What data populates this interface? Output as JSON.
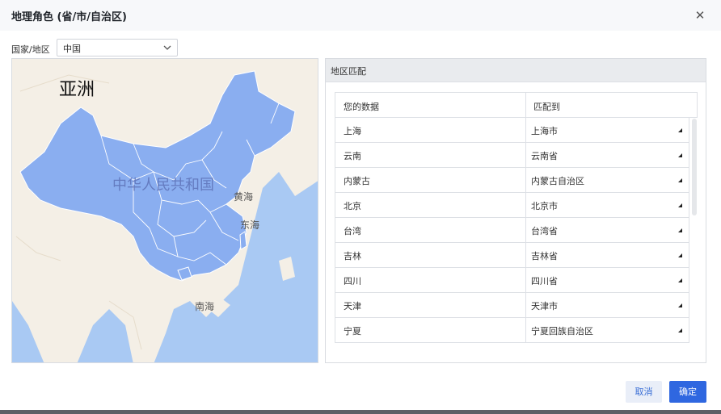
{
  "dialog": {
    "title": "地理角色 (省/市/自治区)",
    "close_glyph": "✕"
  },
  "country": {
    "label": "国家/地区",
    "value": "中国"
  },
  "map": {
    "labels": {
      "asia": "亚洲",
      "country": "中华人民共和国",
      "yellow_sea": "黄海",
      "east_sea": "东海",
      "south_sea": "南海"
    },
    "colors": {
      "water": "#a9c9f3",
      "land": "#f4efe6",
      "region": "#8aaef0",
      "border": "#ffffff"
    }
  },
  "panel": {
    "title": "地区匹配",
    "columns": [
      "您的数据",
      "匹配到"
    ],
    "rows": [
      {
        "data": "上海",
        "match": "上海市"
      },
      {
        "data": "云南",
        "match": "云南省"
      },
      {
        "data": "内蒙古",
        "match": "内蒙古自治区"
      },
      {
        "data": "北京",
        "match": "北京市"
      },
      {
        "data": "台湾",
        "match": "台湾省"
      },
      {
        "data": "吉林",
        "match": "吉林省"
      },
      {
        "data": "四川",
        "match": "四川省"
      },
      {
        "data": "天津",
        "match": "天津市"
      },
      {
        "data": "宁夏",
        "match": "宁夏回族自治区"
      }
    ]
  },
  "footer": {
    "cancel_label": "取消",
    "ok_label": "确定"
  },
  "colors": {
    "primary": "#2f67e0",
    "cancel_bg": "#e9eef8"
  }
}
